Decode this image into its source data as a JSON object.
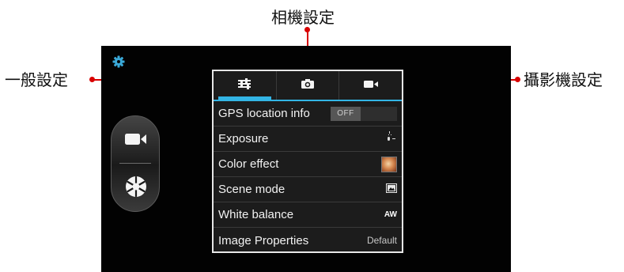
{
  "callouts": {
    "general": "一般設定",
    "camera": "相機設定",
    "video": "攝影機設定"
  },
  "colors": {
    "callout_line": "#d80000",
    "accent": "#33b5e5",
    "gear": "#3aa9d8"
  },
  "screen": {
    "top_icon": "gear-icon",
    "mode_switch": {
      "video_icon": "video-camera-icon",
      "shutter_icon": "shutter-icon"
    }
  },
  "settings_panel": {
    "tabs": [
      {
        "id": "general",
        "icon": "sliders-icon",
        "active": true
      },
      {
        "id": "camera",
        "icon": "camera-icon",
        "active": false
      },
      {
        "id": "video",
        "icon": "video-camera-icon",
        "active": false
      }
    ],
    "rows": {
      "gps": {
        "label": "GPS location info",
        "value": "OFF"
      },
      "exposure": {
        "label": "Exposure",
        "icon": "exposure-icon"
      },
      "color": {
        "label": "Color effect",
        "icon": "color-effect-thumbnail"
      },
      "scene": {
        "label": "Scene mode",
        "icon": "scene-mode-icon"
      },
      "wb": {
        "label": "White balance",
        "icon": "white-balance-auto-icon",
        "icon_text": "AW"
      },
      "image": {
        "label": "Image Properties",
        "value": "Default"
      }
    }
  }
}
